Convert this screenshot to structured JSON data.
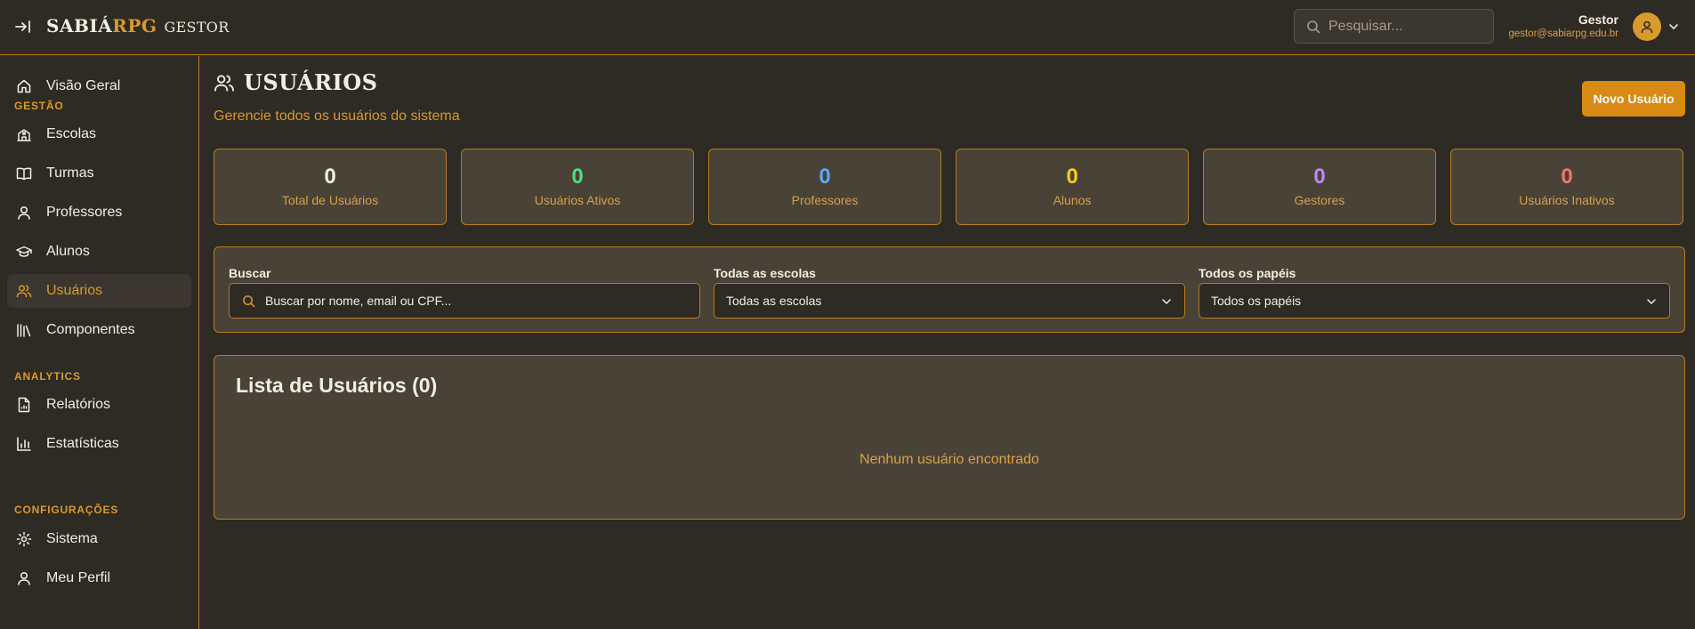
{
  "header": {
    "brand_main": "SABIÁ",
    "brand_accent": "RPG",
    "brand_role": "GESTOR",
    "search_placeholder": "Pesquisar...",
    "user_name": "Gestor",
    "user_email": "gestor@sabiarpg.edu.br"
  },
  "sidebar": {
    "overview": "Visão Geral",
    "section_gestao": "GESTÃO",
    "escolas": "Escolas",
    "turmas": "Turmas",
    "professores": "Professores",
    "alunos": "Alunos",
    "usuarios": "Usuários",
    "componentes": "Componentes",
    "section_analytics": "ANALYTICS",
    "relatorios": "Relatórios",
    "estatisticas": "Estatísticas",
    "section_config": "CONFIGURAÇÕES",
    "sistema": "Sistema",
    "perfil": "Meu Perfil"
  },
  "page": {
    "title": "USUÁRIOS",
    "subtitle": "Gerencie todos os usuários do sistema",
    "new_button": "Novo Usuário"
  },
  "stats": [
    {
      "value": "0",
      "label": "Total de Usuários",
      "color": "#f3ede2"
    },
    {
      "value": "0",
      "label": "Usuários Ativos",
      "color": "#4ade80"
    },
    {
      "value": "0",
      "label": "Professores",
      "color": "#60a5fa"
    },
    {
      "value": "0",
      "label": "Alunos",
      "color": "#facc15"
    },
    {
      "value": "0",
      "label": "Gestores",
      "color": "#c084fc"
    },
    {
      "value": "0",
      "label": "Usuários Inativos",
      "color": "#f87171"
    }
  ],
  "filters": {
    "search_label": "Buscar",
    "search_placeholder": "Buscar por nome, email ou CPF...",
    "school_label": "Todas as escolas",
    "school_value": "Todas as escolas",
    "role_label": "Todos os papéis",
    "role_value": "Todos os papéis"
  },
  "list": {
    "title": "Lista de Usuários (0)",
    "empty": "Nenhum usuário encontrado"
  }
}
